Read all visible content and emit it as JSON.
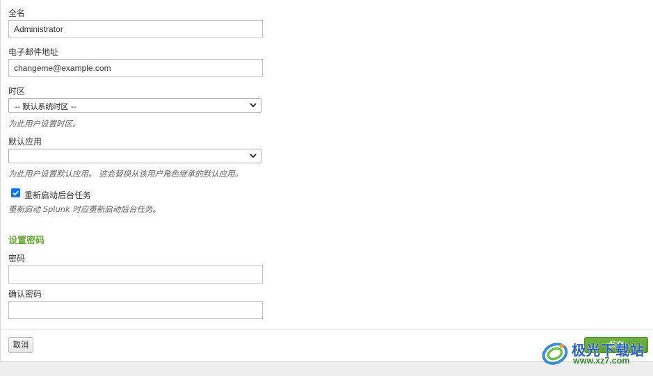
{
  "form": {
    "fullname": {
      "label": "全名",
      "value": "Administrator"
    },
    "email": {
      "label": "电子邮件地址",
      "value": "changeme@example.com"
    },
    "timezone": {
      "label": "时区",
      "selected": "-- 默认系统时区 --",
      "help": "为此用户设置时区。"
    },
    "default_app": {
      "label": "默认应用",
      "selected": "",
      "help": "为此用户设置默认应用。 这会替换从该用户角色继承的默认应用。"
    },
    "restart_tasks": {
      "label": "重新启动后台任务",
      "checked": true,
      "help": "重新启动 Splunk 时应重新启动后台任务。"
    },
    "password_section": {
      "title": "设置密码",
      "password_label": "密码",
      "password_value": "",
      "confirm_label": "确认密码",
      "confirm_value": ""
    }
  },
  "footer": {
    "cancel_label": "取消",
    "save_label": "保存"
  },
  "watermark": {
    "title": "极光下载站",
    "url": "www.xz7.com"
  },
  "colors": {
    "section_title": "#65a637",
    "save_button": "#5a9b32",
    "checkbox": "#0075ff"
  },
  "icons": {
    "select_arrow": "chevron-down-icon",
    "checkbox_mark": "checkmark-icon"
  }
}
